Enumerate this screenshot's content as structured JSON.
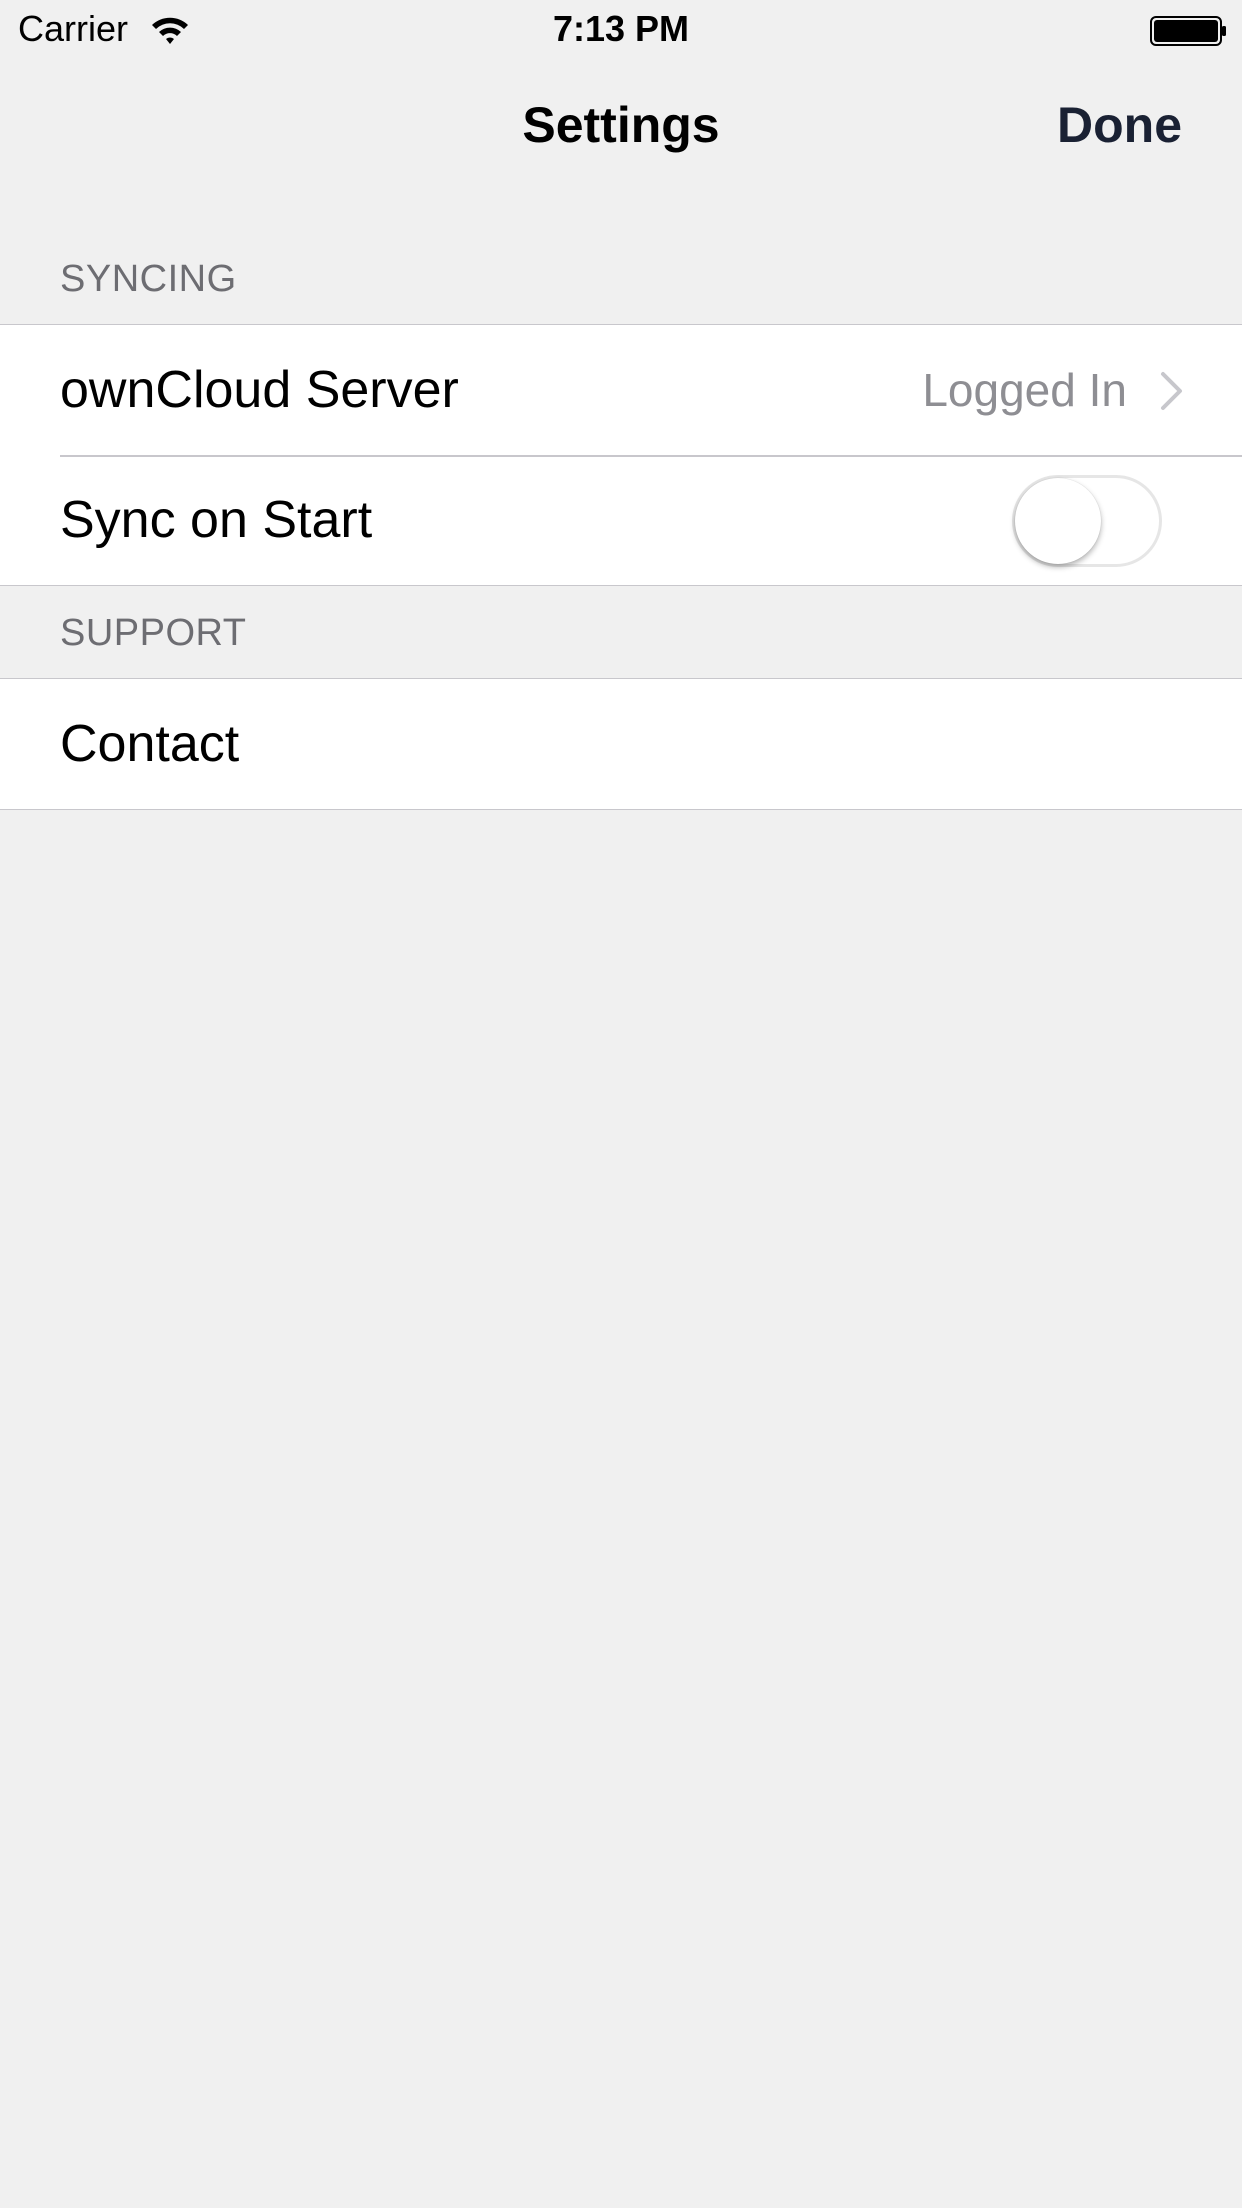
{
  "status_bar": {
    "carrier": "Carrier",
    "time": "7:13 PM",
    "wifi_icon": "wifi-icon",
    "battery_icon": "battery-full-icon"
  },
  "nav": {
    "title": "Settings",
    "done_label": "Done",
    "done_color": "#1a2133"
  },
  "sections": {
    "syncing": {
      "header": "SYNCING",
      "server_label": "ownCloud Server",
      "server_detail": "Logged In",
      "sync_label": "Sync on Start",
      "sync_on_start": false
    },
    "support": {
      "header": "SUPPORT",
      "contact_label": "Contact"
    }
  },
  "colors": {
    "background": "#f0f0f0",
    "cell": "#ffffff",
    "separator": "#c8c7cc",
    "header_text": "#6d6d72",
    "detail_text": "#8e8e93"
  }
}
